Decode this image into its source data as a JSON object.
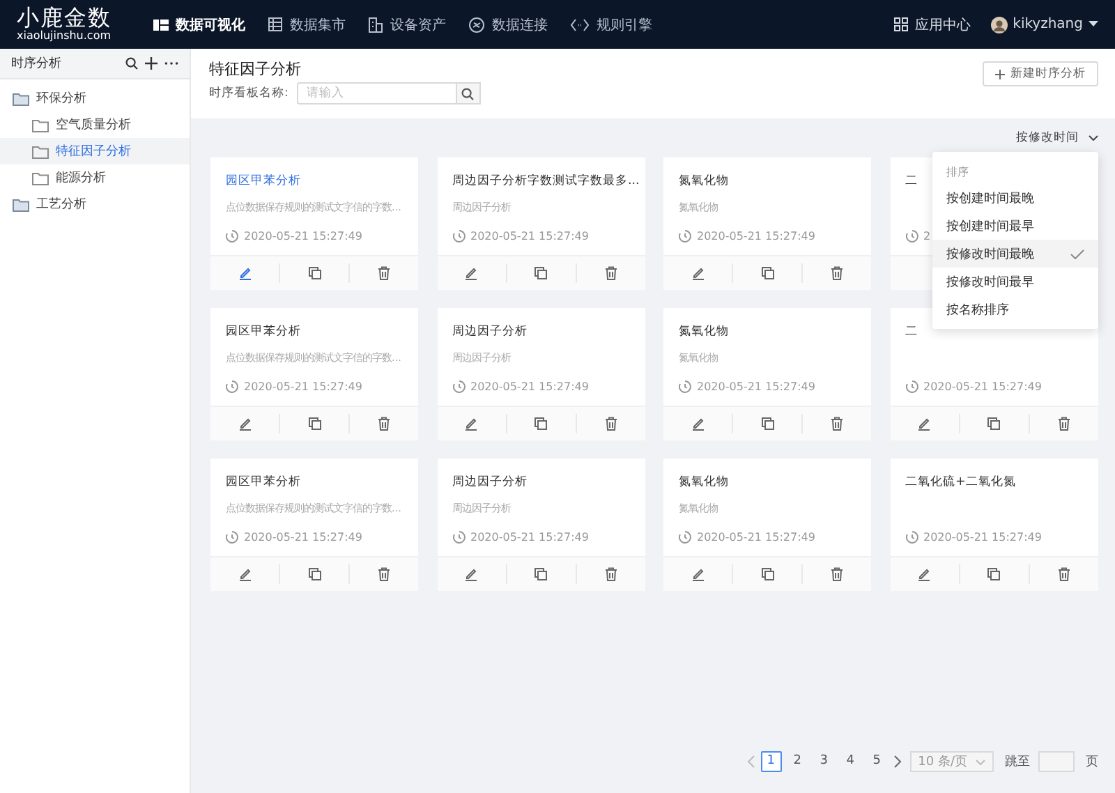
{
  "brand": {
    "name": "小鹿金数",
    "domain": "xiaolujinshu.com"
  },
  "nav": {
    "items": [
      {
        "label": "数据可视化",
        "selected": true,
        "kind": "grid"
      },
      {
        "label": "数据集市",
        "selected": false,
        "kind": "table"
      },
      {
        "label": "设备资产",
        "selected": false,
        "kind": "building"
      },
      {
        "label": "数据连接",
        "selected": false,
        "kind": "link"
      },
      {
        "label": "规则引擎",
        "selected": false,
        "kind": "code"
      }
    ],
    "app_center": "应用中心",
    "user": "kikyzhang"
  },
  "sidebar": {
    "title": "时序分析",
    "tree": [
      {
        "label": "环保分析",
        "selected": false,
        "children": [
          {
            "label": "空气质量分析",
            "selected": false
          },
          {
            "label": "特征因子分析",
            "selected": true
          },
          {
            "label": "能源分析",
            "selected": false
          }
        ]
      },
      {
        "label": "工艺分析",
        "selected": false
      }
    ]
  },
  "page": {
    "title": "特征因子分析",
    "search_label": "时序看板名称:",
    "search_placeholder": "请输入",
    "new_button": "新建时序分析",
    "sort_label": "按修改时间"
  },
  "cards": [
    {
      "title": "园区甲苯分析",
      "subtitle": "点位数据保存规则的测试文字信的字数...",
      "time": "2020-05-21 15:27:49",
      "selected": true,
      "covered": false
    },
    {
      "title": "周边因子分析字数测试字数最多...",
      "subtitle": "周边因子分析",
      "time": "2020-05-21 15:27:49",
      "selected": false,
      "covered": false
    },
    {
      "title": "氮氧化物",
      "subtitle": "氮氧化物",
      "time": "2020-05-21 15:27:49",
      "selected": false,
      "covered": false
    },
    {
      "title": "二",
      "time": "2",
      "selected": false,
      "covered": true
    },
    {
      "title": "园区甲苯分析",
      "subtitle": "点位数据保存规则的测试文字信的字数...",
      "time": "2020-05-21 15:27:49",
      "selected": false,
      "covered": false
    },
    {
      "title": "周边因子分析",
      "subtitle": "周边因子分析",
      "time": "2020-05-21 15:27:49",
      "selected": false,
      "covered": false
    },
    {
      "title": "氮氧化物",
      "subtitle": "氮氧化物",
      "time": "2020-05-21 15:27:49",
      "selected": false,
      "covered": false
    },
    {
      "title": "二",
      "time": "2020-05-21 15:27:49",
      "selected": false,
      "covered": false
    },
    {
      "title": "园区甲苯分析",
      "subtitle": "点位数据保存规则的测试文字信的字数...",
      "time": "2020-05-21 15:27:49",
      "selected": false,
      "covered": false
    },
    {
      "title": "周边因子分析",
      "subtitle": "周边因子分析",
      "time": "2020-05-21 15:27:49",
      "selected": false,
      "covered": false
    },
    {
      "title": "氮氧化物",
      "subtitle": "氮氧化物",
      "time": "2020-05-21 15:27:49",
      "selected": false,
      "covered": false
    },
    {
      "title": "二氧化硫+二氧化氮",
      "time": "2020-05-21 15:27:49",
      "selected": false,
      "covered": false
    }
  ],
  "sort_menu": {
    "header": "排序",
    "items": [
      {
        "label": "按创建时间最晚",
        "selected": false
      },
      {
        "label": "按创建时间最早",
        "selected": false
      },
      {
        "label": "按修改时间最晚",
        "selected": true
      },
      {
        "label": "按修改时间最早",
        "selected": false
      },
      {
        "label": "按名称排序",
        "selected": false
      }
    ]
  },
  "pagination": {
    "pages": [
      {
        "label": "1",
        "selected": true
      },
      {
        "label": "2",
        "selected": false
      },
      {
        "label": "3",
        "selected": false
      },
      {
        "label": "4",
        "selected": false
      },
      {
        "label": "5",
        "selected": false
      }
    ],
    "page_size": "10 条/页",
    "jump_label": "跳至",
    "page_unit": "页"
  }
}
